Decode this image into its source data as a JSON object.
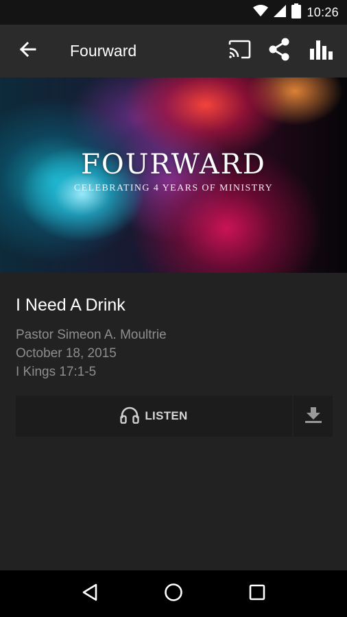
{
  "status_bar": {
    "time": "10:26",
    "icons": [
      "wifi-icon",
      "cell-signal-icon",
      "battery-icon"
    ]
  },
  "app_bar": {
    "title": "Fourward",
    "actions": [
      "cast-icon",
      "share-icon",
      "bar-chart-icon"
    ]
  },
  "hero": {
    "title": "FOURWARD",
    "subtitle": "CELEBRATING 4 YEARS OF MINISTRY"
  },
  "sermon": {
    "title": "I Need A Drink",
    "speaker": "Pastor Simeon A. Moultrie",
    "date": "October 18, 2015",
    "scripture": "I Kings 17:1-5"
  },
  "actions": {
    "listen_label": "LISTEN",
    "listen_icon": "headphones-icon",
    "download_icon": "download-icon"
  },
  "nav_bar": {
    "buttons": [
      "back-triangle-icon",
      "home-circle-icon",
      "recents-square-icon"
    ]
  },
  "colors": {
    "background": "#222222",
    "app_bar": "#2b2b2b",
    "status_bar": "#141414",
    "button": "#1c1c1c",
    "meta_text": "#8e8e8e"
  }
}
